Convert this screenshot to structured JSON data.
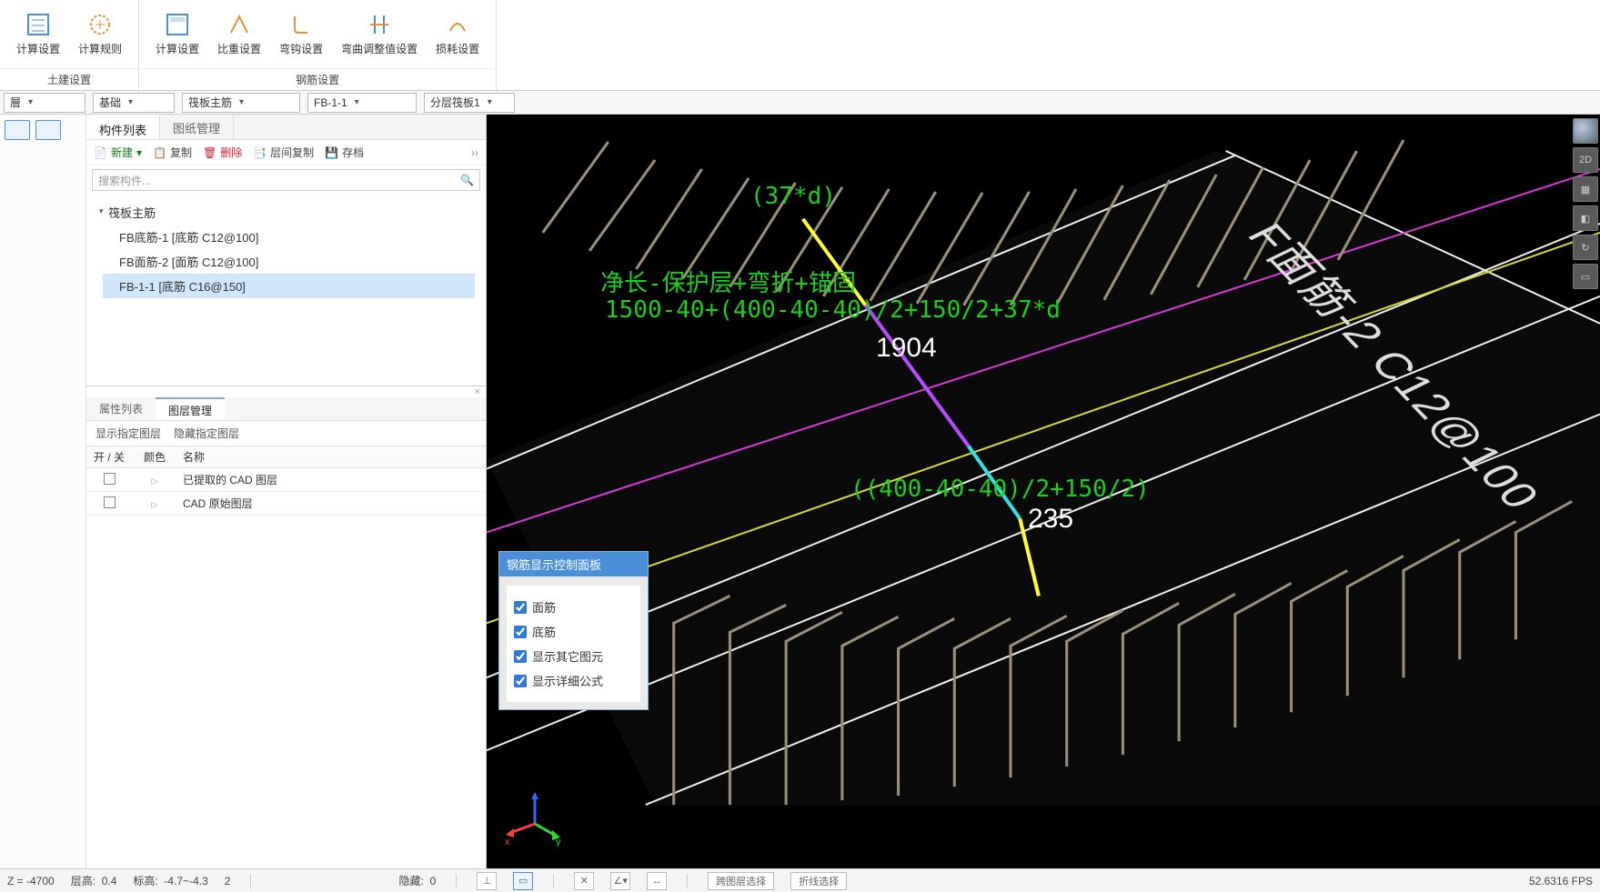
{
  "ribbon": {
    "groups": [
      {
        "label": "土建设置",
        "items": [
          {
            "id": "calc-settings-1",
            "label": "计算设置"
          },
          {
            "id": "calc-rules",
            "label": "计算规则"
          }
        ]
      },
      {
        "label": "钢筋设置",
        "items": [
          {
            "id": "calc-settings-2",
            "label": "计算设置"
          },
          {
            "id": "weight-settings",
            "label": "比重设置"
          },
          {
            "id": "hook-settings",
            "label": "弯钩设置"
          },
          {
            "id": "bend-adjust",
            "label": "弯曲调整值设置"
          },
          {
            "id": "loss-settings",
            "label": "损耗设置"
          }
        ]
      }
    ]
  },
  "selectors": {
    "floor": "層",
    "category": "基础",
    "type": "筏板主筋",
    "component": "FB-1-1",
    "layer": "分层筏板1"
  },
  "panel": {
    "tabs": {
      "components": "构件列表",
      "drawings": "图纸管理"
    },
    "toolbar": {
      "new": "新建",
      "copy": "复制",
      "delete": "删除",
      "layercopy": "层间复制",
      "save": "存档"
    },
    "search_placeholder": "搜索构件...",
    "tree": {
      "root": "筏板主筋",
      "items": [
        "FB底筋-1 [底筋 C12@100]",
        "FB面筋-2 [面筋 C12@100]",
        "FB-1-1 [底筋 C16@150]"
      ],
      "selected_index": 2
    }
  },
  "subpanel": {
    "tabs": {
      "props": "属性列表",
      "layers": "图层管理"
    },
    "ops": {
      "show": "显示指定图层",
      "hide": "隐藏指定图层"
    },
    "columns": {
      "on": "开 / 关",
      "color": "颜色",
      "name": "名称"
    },
    "rows": [
      {
        "name": "已提取的 CAD 图层"
      },
      {
        "name": "CAD 原始图层"
      }
    ]
  },
  "float_panel": {
    "title": "钢筋显示控制面板",
    "items": [
      "面筋",
      "底筋",
      "显示其它图元",
      "显示详细公式"
    ]
  },
  "viewport": {
    "anno_37d": "(37*d)",
    "anno_desc": "净长-保护层+弯折+锚固",
    "anno_formula": "1500-40+(400-40-40)/2+150/2+37*d",
    "anno_1904": "1904",
    "anno_formula2": "((400-40-40)/2+150/2)",
    "anno_235": "235",
    "label3d": "F面筋-2 C12@100"
  },
  "status": {
    "z": "Z = -4700",
    "floor_h_label": "层高:",
    "floor_h": "0.4",
    "elev_label": "标高:",
    "elev": "-4.7~-4.3",
    "extra": "2",
    "hidden_label": "隐藏:",
    "hidden": "0",
    "cross_layer": "跨图层选择",
    "polyline": "折线选择",
    "fps": "52.6316 FPS"
  },
  "gizmo": {
    "x": "x",
    "y": "y"
  }
}
